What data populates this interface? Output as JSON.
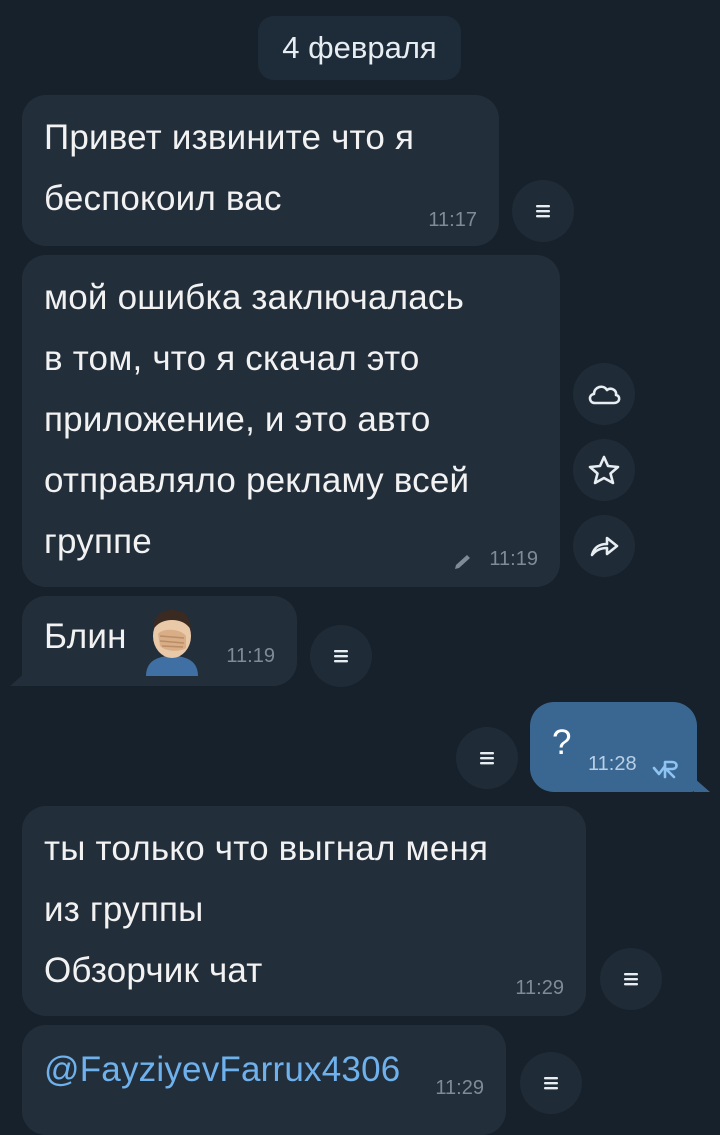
{
  "date_header": "4 февраля",
  "messages": [
    {
      "text": "Привет извините что я\nбеспокоил вас",
      "time": "11:17"
    },
    {
      "text": "мой ошибка заключалась\nв том, что я скачал это\nприложение, и это авто\nотправляло рекламу всей\nгруппе",
      "time": "11:19"
    },
    {
      "text": "Блин",
      "time": "11:19"
    },
    {
      "text": "?",
      "time": "11:28"
    },
    {
      "text": "ты только что выгнал меня\nиз группы\nОбзорчик чат",
      "time": "11:29"
    },
    {
      "text": "@FayziyevFarrux4306",
      "time": "11:29"
    }
  ],
  "icons": {
    "menu": "menu-icon",
    "cloud": "cloud-icon",
    "star": "star-icon",
    "share": "share-icon",
    "edited": "pencil-icon",
    "facepalm": "facepalm-emoji",
    "read_status": "read-receipt-icon"
  },
  "colors": {
    "background": "#17212b",
    "incoming_bubble": "#222e3a",
    "outgoing_bubble": "#3a6792",
    "link": "#6fb1ec"
  }
}
